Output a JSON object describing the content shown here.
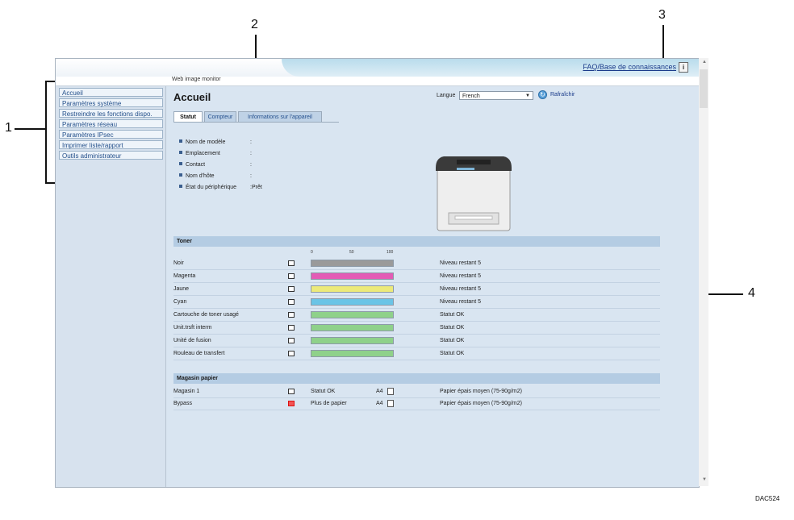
{
  "callouts": {
    "c1": "1",
    "c2": "2",
    "c3": "3",
    "c4": "4"
  },
  "header": {
    "faq_link": "FAQ/Base de connaissances",
    "info_icon": "i",
    "product": "Web image monitor"
  },
  "sidebar": {
    "items": [
      {
        "label": "Accueil"
      },
      {
        "label": "Paramètres système"
      },
      {
        "label": "Restreindre les fonctions dispo."
      },
      {
        "label": "Paramètres réseau"
      },
      {
        "label": "Paramètres IPsec"
      },
      {
        "label": "Imprimer liste/rapport"
      },
      {
        "label": "Outils administrateur"
      }
    ]
  },
  "page": {
    "title": "Accueil",
    "language_label": "Langue",
    "language_value": "French",
    "refresh_label": "Rafraîchir"
  },
  "tabs": [
    {
      "label": "Statut",
      "active": true
    },
    {
      "label": "Compteur",
      "active": false
    },
    {
      "label": "Informations sur l'appareil",
      "active": false
    }
  ],
  "device": [
    {
      "label": "Nom de modèle",
      "value": ":"
    },
    {
      "label": "Emplacement",
      "value": ":"
    },
    {
      "label": "Contact",
      "value": ":"
    },
    {
      "label": "Nom d'hôte",
      "value": ":"
    },
    {
      "label": "État du périphérique",
      "value": ":Prêt"
    }
  ],
  "toner": {
    "heading": "Toner",
    "scale": [
      "0",
      "50",
      "100"
    ],
    "rows": [
      {
        "name": "Noir",
        "status": "Niveau restant 5",
        "level": 1.0,
        "color": "#9a9a9a",
        "icon": "toner-bottle-icon"
      },
      {
        "name": "Magenta",
        "status": "Niveau restant 5",
        "level": 1.0,
        "color": "#e35bb5",
        "icon": "toner-bottle-icon"
      },
      {
        "name": "Jaune",
        "status": "Niveau restant 5",
        "level": 1.0,
        "color": "#ecea7a",
        "icon": "toner-bottle-icon"
      },
      {
        "name": "Cyan",
        "status": "Niveau restant 5",
        "level": 1.0,
        "color": "#6ac4e6",
        "icon": "toner-bottle-icon"
      },
      {
        "name": "Cartouche de toner usagé",
        "status": "Statut OK",
        "level": 1.0,
        "color": "#8fd18a",
        "icon": "waste-toner-icon"
      },
      {
        "name": "Unit.trsft interm",
        "status": "Statut OK",
        "level": 1.0,
        "color": "#8fd18a",
        "icon": "unit-icon"
      },
      {
        "name": "Unité de fusion",
        "status": "Statut OK",
        "level": 1.0,
        "color": "#8fd18a",
        "icon": "unit-icon"
      },
      {
        "name": "Rouleau de transfert",
        "status": "Statut OK",
        "level": 1.0,
        "color": "#8fd18a",
        "icon": "unit-icon"
      }
    ]
  },
  "paper": {
    "heading": "Magasin papier",
    "rows": [
      {
        "name": "Magasin 1",
        "status": "Statut OK",
        "size": "A4",
        "type": "Papier épais moyen (75-90g/m2)",
        "warning": false
      },
      {
        "name": "Bypass",
        "status": "Plus de papier",
        "size": "A4",
        "type": "Papier épais moyen (75-90g/m2)",
        "warning": true
      }
    ]
  },
  "footer": {
    "figure_id": "DAC524"
  }
}
